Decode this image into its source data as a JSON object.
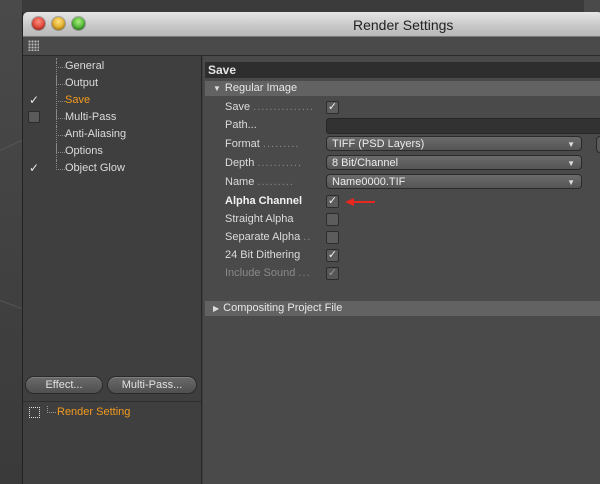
{
  "window": {
    "title": "Render Settings"
  },
  "sidebar": {
    "items": [
      {
        "label": "General",
        "checked": false,
        "checkbox": "none"
      },
      {
        "label": "Output",
        "checked": false,
        "checkbox": "none"
      },
      {
        "label": "Save",
        "checked": true,
        "checkbox": "check",
        "active": true
      },
      {
        "label": "Multi-Pass",
        "checked": false,
        "checkbox": "box"
      },
      {
        "label": "Anti-Aliasing",
        "checked": false,
        "checkbox": "none"
      },
      {
        "label": "Options",
        "checked": false,
        "checkbox": "none"
      },
      {
        "label": "Object Glow",
        "checked": true,
        "checkbox": "check"
      }
    ],
    "check_glyph": "✓",
    "effect_button": "Effect...",
    "multipass_button": "Multi-Pass...",
    "render_setting": "Render Setting"
  },
  "main": {
    "section_title": "Save",
    "regular_image": {
      "header": "Regular Image",
      "save_label": "Save",
      "save_checked": true,
      "path_label": "Path...",
      "path_value": "",
      "format_label": "Format",
      "format_value": "TIFF (PSD Layers)",
      "depth_label": "Depth",
      "depth_value": "8 Bit/Channel",
      "name_label": "Name",
      "name_value": "Name0000.TIF",
      "alpha_label": "Alpha Channel",
      "alpha_checked": true,
      "straight_alpha_label": "Straight Alpha",
      "straight_alpha_checked": false,
      "separate_alpha_label": "Separate Alpha",
      "separate_alpha_checked": false,
      "dithering_label": "24 Bit Dithering",
      "dithering_checked": true,
      "include_sound_label": "Include Sound",
      "include_sound_checked": true
    },
    "compositing_header": "Compositing Project File"
  },
  "colors": {
    "accent_orange": "#f39a1e",
    "annotation_arrow": "#e8281e"
  },
  "glyphs": {
    "tri_down": "▼",
    "tri_right": "▶",
    "chevron_down": "▼",
    "dots_save": "...............",
    "dots_path": "",
    "dots_format": ".........",
    "dots_depth": "...........",
    "dots_name": ".........",
    "dots_separate": "..",
    "dots_sound": "..."
  }
}
